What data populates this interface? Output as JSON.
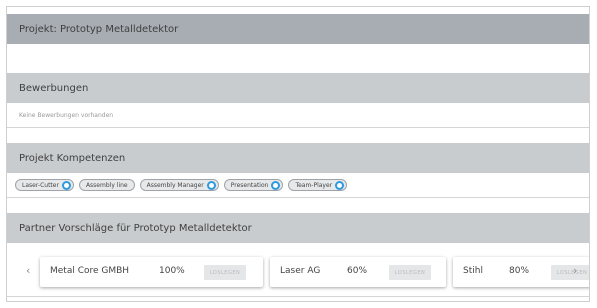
{
  "project": {
    "title": "Projekt: Prototyp Metalldetektor"
  },
  "applications": {
    "title": "Bewerbungen",
    "empty_text": "Keine Bewerbungen vorhanden"
  },
  "competencies": {
    "title": "Projekt Kompetenzen",
    "chips": [
      {
        "label": "Laser-Cutter",
        "has_icon": true
      },
      {
        "label": "Assembly line",
        "has_icon": false
      },
      {
        "label": "Assembly Manager",
        "has_icon": true
      },
      {
        "label": "Presentation",
        "has_icon": true
      },
      {
        "label": "Team-Player",
        "has_icon": true
      }
    ]
  },
  "partners": {
    "title": "Partner Vorschläge für Prototyp Metalldetektor",
    "prev_icon": "‹",
    "next_icon": "›",
    "cards": [
      {
        "name": "Metal Core GMBH",
        "match": "100%",
        "button": "LOSLEGEN"
      },
      {
        "name": "Laser AG",
        "match": "60%",
        "button": "LOSLEGEN"
      },
      {
        "name": "Stihl",
        "match": "80%",
        "button": "LOSLEGEN"
      }
    ]
  },
  "colors": {
    "header_dark": "#a7adb3",
    "header_light": "#c9cccf",
    "chip_icon": "#2d9ae0"
  }
}
